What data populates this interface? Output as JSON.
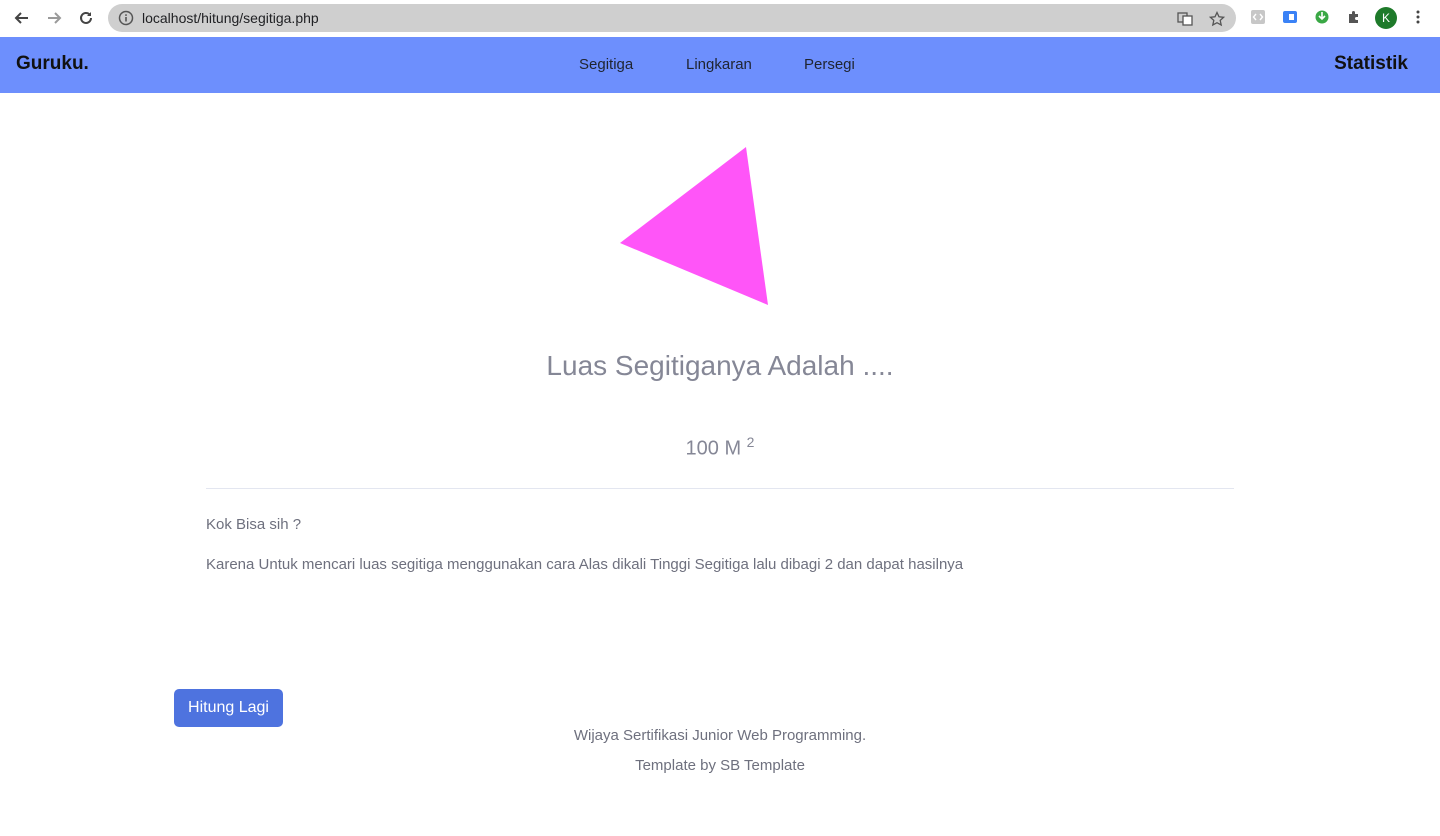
{
  "browser": {
    "url": "localhost/hitung/segitiga.php",
    "profile_initial": "K"
  },
  "navbar": {
    "brand": "Guruku.",
    "links": [
      "Segitiga",
      "Lingkaran",
      "Persegi"
    ],
    "right_link": "Statistik",
    "bg_color": "#6d8ffd"
  },
  "main": {
    "shape_color": "#ff55f8",
    "result_title": "Luas Segitiganya Adalah ....",
    "result_value": "100 M",
    "result_unit_exp": "2",
    "question": "Kok Bisa sih ?",
    "explanation": "Karena Untuk mencari luas segitiga menggunakan cara Alas dikali Tinggi Segitiga lalu dibagi 2 dan dapat hasilnya",
    "button_label": "Hitung Lagi",
    "button_color": "#4e73df"
  },
  "footer": {
    "line1": "Wijaya Sertifikasi Junior Web Programming.",
    "line2": "Template by SB Template"
  }
}
